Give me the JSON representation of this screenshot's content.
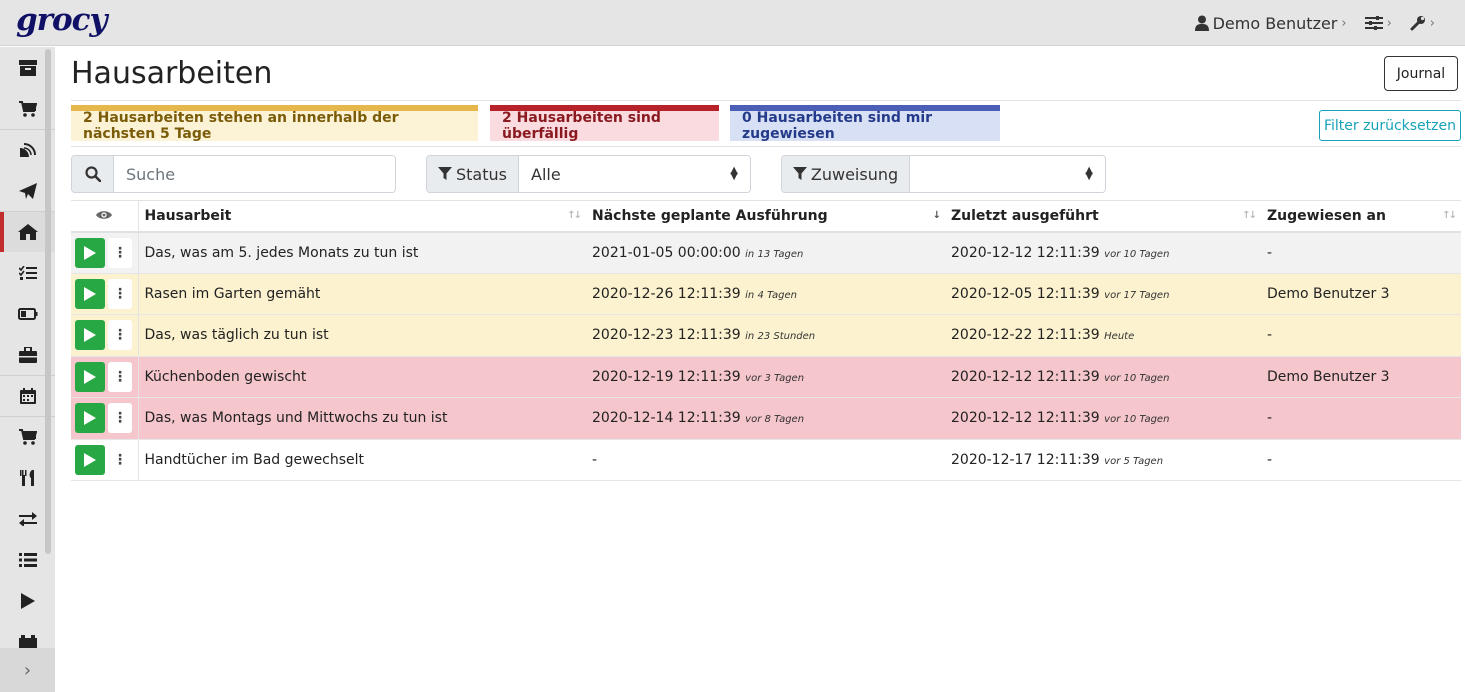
{
  "app": {
    "logo": "grocy"
  },
  "topnav": {
    "user": "Demo Benutzer"
  },
  "sidebar": {
    "items": [
      {
        "icon": "box-icon"
      },
      {
        "icon": "cart-icon"
      },
      {
        "icon": "satellite-icon"
      },
      {
        "icon": "paper-plane-icon"
      },
      {
        "icon": "home-icon",
        "active": true
      },
      {
        "icon": "tasks-icon"
      },
      {
        "icon": "battery-icon"
      },
      {
        "icon": "toolbox-icon"
      },
      {
        "icon": "calendar-icon"
      },
      {
        "icon": "cart-plus-icon"
      },
      {
        "icon": "utensils-icon"
      },
      {
        "icon": "exchange-icon"
      },
      {
        "icon": "list-icon"
      },
      {
        "icon": "play-icon"
      },
      {
        "icon": "car-battery-icon"
      }
    ],
    "toggle": "›"
  },
  "page": {
    "title": "Hausarbeiten",
    "journal_button": "Journal",
    "reset_button": "Filter zurücksetzen",
    "badges": {
      "due_soon": "2 Hausarbeiten stehen an innerhalb der nächsten 5 Tage",
      "overdue": "2 Hausarbeiten sind überfällig",
      "assigned": "0 Hausarbeiten sind mir zugewiesen"
    },
    "filters": {
      "search_placeholder": "Suche",
      "status_label": "Status",
      "status_value": "Alle",
      "assignment_label": "Zuweisung",
      "assignment_value": ""
    }
  },
  "table": {
    "headers": {
      "chore": "Hausarbeit",
      "next": "Nächste geplante Ausführung",
      "last": "Zuletzt ausgeführt",
      "assigned": "Zugewiesen an"
    },
    "rows": [
      {
        "name": "Das, was am 5. jedes Monats zu tun ist",
        "next": "2021-01-05 00:00:00",
        "next_rel": "in 13 Tagen",
        "last": "2020-12-12 12:11:39",
        "last_rel": "vor 10 Tagen",
        "assigned": "-"
      },
      {
        "name": "Rasen im Garten gemäht",
        "next": "2020-12-26 12:11:39",
        "next_rel": "in 4 Tagen",
        "last": "2020-12-05 12:11:39",
        "last_rel": "vor 17 Tagen",
        "assigned": "Demo Benutzer 3"
      },
      {
        "name": "Das, was täglich zu tun ist",
        "next": "2020-12-23 12:11:39",
        "next_rel": "in 23 Stunden",
        "last": "2020-12-22 12:11:39",
        "last_rel": "Heute",
        "assigned": "-"
      },
      {
        "name": "Küchenboden gewischt",
        "next": "2020-12-19 12:11:39",
        "next_rel": "vor 3 Tagen",
        "last": "2020-12-12 12:11:39",
        "last_rel": "vor 10 Tagen",
        "assigned": "Demo Benutzer 3"
      },
      {
        "name": "Das, was Montags und Mittwochs zu tun ist",
        "next": "2020-12-14 12:11:39",
        "next_rel": "vor 8 Tagen",
        "last": "2020-12-12 12:11:39",
        "last_rel": "vor 10 Tagen",
        "assigned": "-"
      },
      {
        "name": "Handtücher im Bad gewechselt",
        "next": "-",
        "next_rel": "",
        "last": "2020-12-17 12:11:39",
        "last_rel": "vor 5 Tagen",
        "assigned": "-"
      }
    ]
  },
  "colors": {
    "due_soon": "#e6b84c",
    "overdue": "#b8232a",
    "assigned": "#4a5fb5",
    "play": "#28a745",
    "accent": "#17a2b8"
  }
}
